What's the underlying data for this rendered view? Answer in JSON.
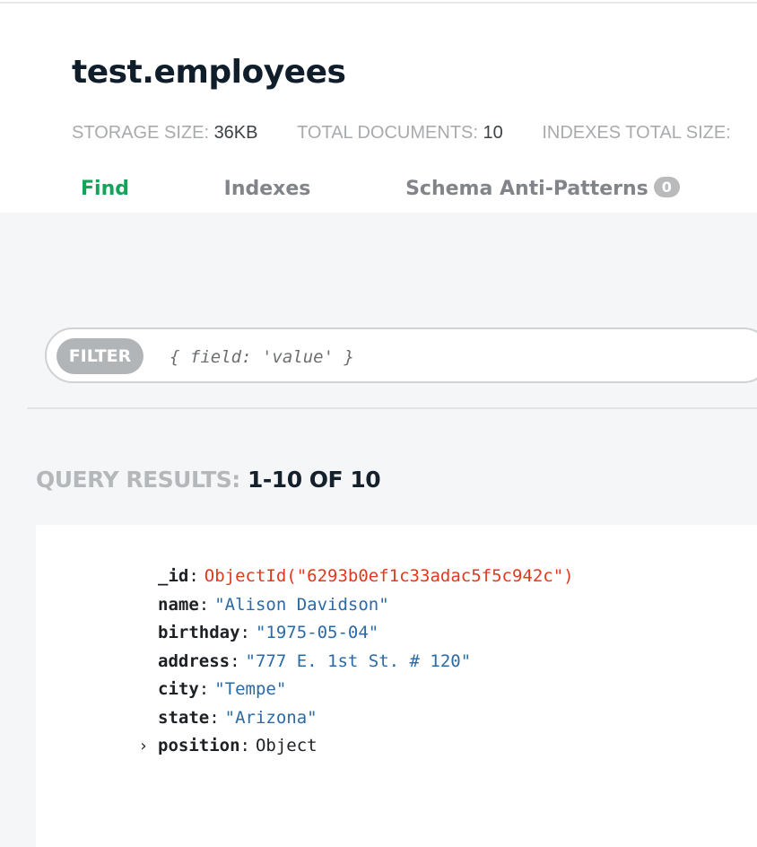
{
  "collection": {
    "title": "test.employees",
    "stats": [
      {
        "label": "STORAGE SIZE:",
        "value": "36KB"
      },
      {
        "label": "TOTAL DOCUMENTS:",
        "value": "10"
      },
      {
        "label": "INDEXES TOTAL SIZE:",
        "value": ""
      }
    ]
  },
  "tabs": [
    {
      "label": "Find",
      "active": true
    },
    {
      "label": "Indexes",
      "active": false
    },
    {
      "label": "Schema Anti-Patterns",
      "badge": "0",
      "active": false
    }
  ],
  "filter": {
    "pill_label": "FILTER",
    "placeholder": "{ field: 'value' }"
  },
  "results": {
    "label": "QUERY RESULTS:",
    "value": "1-10 OF 10"
  },
  "document": {
    "fields": [
      {
        "key": "_id",
        "value": "ObjectId(\"6293b0ef1c33adac5f5c942c\")",
        "type": "objectid"
      },
      {
        "key": "name",
        "value": "\"Alison Davidson\"",
        "type": "string"
      },
      {
        "key": "birthday",
        "value": "\"1975-05-04\"",
        "type": "string"
      },
      {
        "key": "address",
        "value": "\"777 E. 1st St. # 120\"",
        "type": "string"
      },
      {
        "key": "city",
        "value": "\"Tempe\"",
        "type": "string"
      },
      {
        "key": "state",
        "value": "\"Arizona\"",
        "type": "string"
      },
      {
        "key": "position",
        "value": "Object",
        "type": "object",
        "expand_icon": "chevron-right-icon",
        "expand_glyph": "›"
      }
    ]
  },
  "colors": {
    "accent": "#13a35b",
    "objectid": "#e0391e",
    "string": "#2b6aa5"
  }
}
